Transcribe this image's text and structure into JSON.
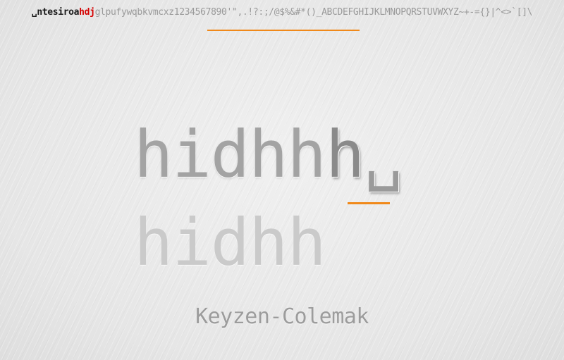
{
  "charset": {
    "typed_black": "␣ntesiroa",
    "typed_red": "hdj",
    "remaining": "glpufywqbkvmcxz1234567890'\",.!?:;/@$%&#*()_ABCDEFGHIJKLMNOPQRSTUVWXYZ~+-={}|^<>`[]\\",
    "progress_fraction": 0.27
  },
  "typing": {
    "typed_text": "hidhh",
    "current_char": "h",
    "cursor_glyph": "␣"
  },
  "next_word": "hidhh",
  "layout_name": "Keyzen-Colemak",
  "colors": {
    "accent": "#f0891a",
    "error_red": "#d40000",
    "background": "#e9e9e9"
  }
}
